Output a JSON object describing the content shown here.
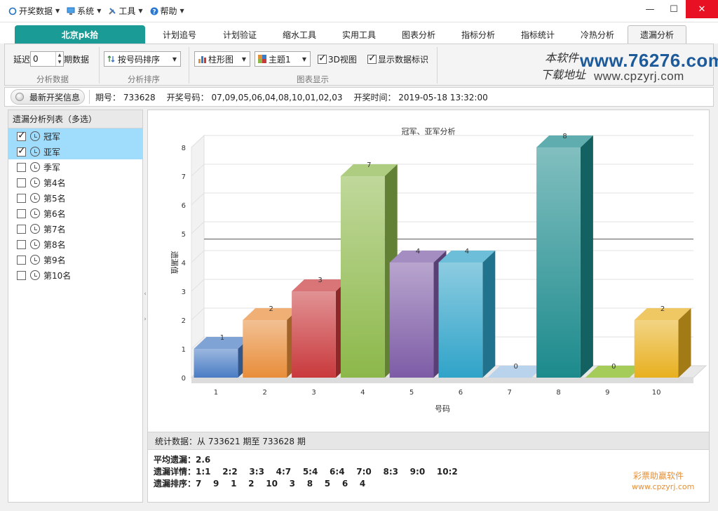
{
  "menu": {
    "items": [
      {
        "label": "开奖数据",
        "icon": "circle-icon"
      },
      {
        "label": "系统",
        "icon": "monitor-icon"
      },
      {
        "label": "工具",
        "icon": "tools-icon"
      },
      {
        "label": "帮助",
        "icon": "help-icon"
      }
    ]
  },
  "window": {
    "minimize": "—",
    "maximize": "☐",
    "close": "✕"
  },
  "tabs": {
    "brand": "北京pk拾",
    "items": [
      "计划追号",
      "计划验证",
      "缩水工具",
      "实用工具",
      "图表分析",
      "指标分析",
      "指标统计",
      "冷热分析",
      "遗漏分析"
    ],
    "active": "遗漏分析"
  },
  "ribbon": {
    "delay_label": "延迟",
    "delay_value": "0",
    "period_label": "期数据",
    "group1": "分析数据",
    "sort_value": "按号码排序",
    "group2": "分析排序",
    "chart_type": "柱形图",
    "theme": "主题1",
    "view3d_label": "3D视图",
    "view3d_checked": true,
    "show_labels_label": "显示数据标识",
    "show_labels_checked": true,
    "group3": "图表显示"
  },
  "logo": {
    "cn1": "本软件",
    "cn2": "下载地址",
    "url1": "www.76276.com",
    "url2": "www.cpzyrj.com"
  },
  "info": {
    "button": "最新开奖信息",
    "period": "期号： 733628",
    "numbers": "开奖号码： 07,09,05,06,04,08,10,01,02,03",
    "time": "开奖时间： 2019-05-18 13:32:00"
  },
  "left_panel": {
    "header": "遗漏分析列表（多选）",
    "items": [
      {
        "label": "冠军",
        "checked": true
      },
      {
        "label": "亚军",
        "checked": true
      },
      {
        "label": "季军",
        "checked": false
      },
      {
        "label": "第4名",
        "checked": false
      },
      {
        "label": "第5名",
        "checked": false
      },
      {
        "label": "第6名",
        "checked": false
      },
      {
        "label": "第7名",
        "checked": false
      },
      {
        "label": "第8名",
        "checked": false
      },
      {
        "label": "第9名",
        "checked": false
      },
      {
        "label": "第10名",
        "checked": false
      }
    ]
  },
  "chart_data": {
    "type": "bar",
    "title": "冠军、亚军分析",
    "xlabel": "号码",
    "ylabel": "遗漏值",
    "categories": [
      "1",
      "2",
      "3",
      "4",
      "5",
      "6",
      "7",
      "8",
      "9",
      "10"
    ],
    "values": [
      1,
      2,
      3,
      7,
      4,
      4,
      0,
      8,
      0,
      2
    ],
    "ylim": [
      0,
      8
    ],
    "yticks": [
      "0",
      "1",
      "2",
      "3",
      "4",
      "5",
      "6",
      "7",
      "8"
    ],
    "average_line": 4.4,
    "colors": [
      "#4a7cc4",
      "#e88d3a",
      "#c9393c",
      "#8cb84a",
      "#7d5ca6",
      "#2fa3c8",
      "#a9c8e8",
      "#1c8a8c",
      "#8fbe2e",
      "#e8b020"
    ],
    "grid": true,
    "view3d": true
  },
  "stats": {
    "header": "统计数据：从 733621 期至 733628 期",
    "avg": "平均遗漏：2.6",
    "detail": "遗漏详情：1:1    2:2    3:3    4:7    5:4    6:4    7:0    8:3    9:0    10:2",
    "rank": "遗漏排序：7    9    1    2    10    3    8    5    6    4"
  },
  "watermark": {
    "line1": "彩票助赢软件",
    "line2": "www.cpzyrj.com"
  }
}
